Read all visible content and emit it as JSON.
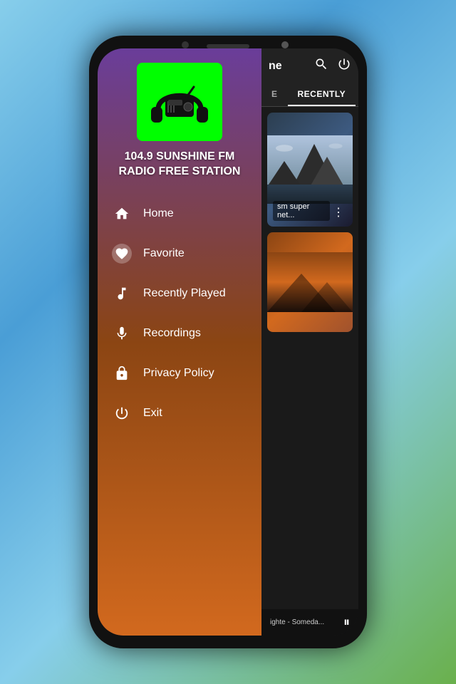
{
  "app": {
    "title": "104.9 SUNSHINE FM RADIO FREE STATION",
    "logo_alt": "Radio headphones icon"
  },
  "header": {
    "title": "ne",
    "search_label": "Search",
    "power_label": "Power"
  },
  "tabs": [
    {
      "label": "E",
      "active": false
    },
    {
      "label": "RECENTLY",
      "active": true
    }
  ],
  "nav_items": [
    {
      "id": "home",
      "label": "Home",
      "icon": "home"
    },
    {
      "id": "favorite",
      "label": "Favorite",
      "icon": "heart",
      "highlighted": true
    },
    {
      "id": "recently-played",
      "label": "Recently Played",
      "icon": "music"
    },
    {
      "id": "recordings",
      "label": "Recordings",
      "icon": "mic"
    },
    {
      "id": "privacy-policy",
      "label": "Privacy Policy",
      "icon": "lock"
    },
    {
      "id": "exit",
      "label": "Exit",
      "icon": "power"
    }
  ],
  "stations": [
    {
      "label": "sm super net...",
      "has_menu": true
    },
    {
      "label": "",
      "has_menu": false
    }
  ],
  "player": {
    "track": "ighte - Someda...",
    "playing": true
  },
  "colors": {
    "drawer_top": "#6a3d9a",
    "drawer_bottom": "#D2691E",
    "logo_bg": "#00ff00",
    "accent": "#fff"
  }
}
